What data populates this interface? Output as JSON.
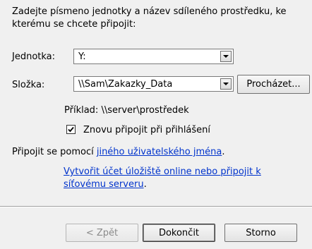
{
  "instruction": "Zadejte písmeno jednotky a název sdíleného prostředku, ke kterému se chcete připojit:",
  "drive": {
    "label": "Jednotka:",
    "value": "Y:"
  },
  "folder": {
    "label": "Složka:",
    "value": "\\\\Sam\\Zakazky_Data",
    "browse_label": "Procházet..."
  },
  "example": "Příklad: \\\\server\\prostředek",
  "reconnect": {
    "label": "Znovu připojit při přihlášení",
    "checked": true
  },
  "other_user": {
    "prefix": "Připojit se pomocí ",
    "link": "jiného uživatelského jména",
    "suffix": "."
  },
  "online_storage": {
    "line1": "Vytvořit účet úložiště online nebo připojit k",
    "line2_link": "síťovému serveru",
    "line2_suffix": "."
  },
  "footer": {
    "back_label": "< Zpět",
    "finish_label": "Dokončit",
    "cancel_label": "Storno"
  }
}
